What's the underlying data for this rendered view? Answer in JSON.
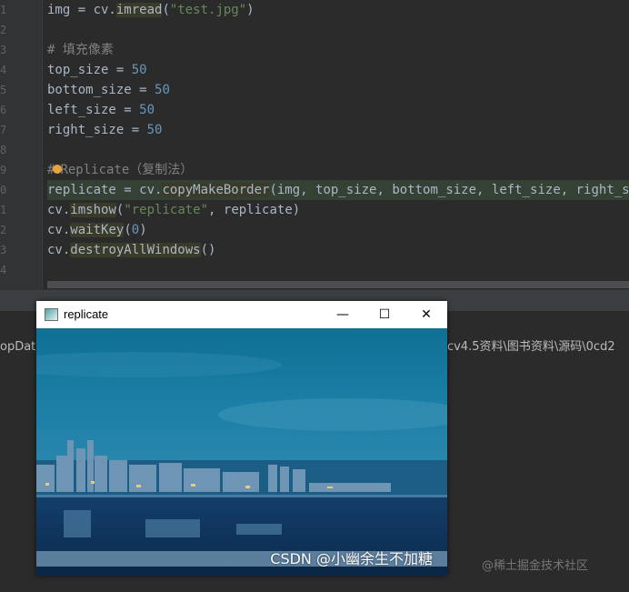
{
  "gutter": {
    "line_numbers": [
      "1",
      "2",
      "3",
      "4",
      "5",
      "6",
      "7",
      "8",
      "9",
      "0",
      "1",
      "2",
      "3",
      "4"
    ]
  },
  "code": {
    "l1": {
      "a": "img = cv.",
      "fn": "imread",
      "b": "(",
      "s": "\"test.jpg\"",
      "c": ")"
    },
    "l3": {
      "cmt": "# 填充像素"
    },
    "l4": {
      "a": "top_size = ",
      "n": "50"
    },
    "l5": {
      "a": "bottom_size = ",
      "n": "50"
    },
    "l6": {
      "a": "left_size = ",
      "n": "50"
    },
    "l7": {
      "a": "right_size = ",
      "n": "50"
    },
    "l9": {
      "c1": "#",
      "c2": "Replicate（复制法）"
    },
    "l10": {
      "a": "replicate = cv.",
      "fn": "copyMakeBorder",
      "b": "(img, top_size, bottom_size, left_size, right_size,"
    },
    "l11": {
      "a": "cv.",
      "fn": "imshow",
      "b": "(",
      "s": "\"replicate\"",
      "c": ", replicate)"
    },
    "l12": {
      "a": "cv.",
      "fn": "waitKey",
      "b": "(",
      "n": "0",
      "c": ")"
    },
    "l13": {
      "a": "cv.",
      "fn": "destroyAllWindows",
      "b": "()"
    }
  },
  "console": {
    "left_text": "opData",
    "right_text": "cv4.5资料\\图书资料\\源码\\0cd2"
  },
  "window": {
    "title": "replicate",
    "minimize": "—",
    "maximize": "☐",
    "close": "✕"
  },
  "watermark": {
    "main": "CSDN @小幽余生不加糖",
    "faint": "@稀土掘金技术社区"
  },
  "colors": {
    "editor_bg": "#2b2b2b",
    "string": "#6a8759",
    "number": "#6897bb",
    "comment": "#808080",
    "text": "#a9b7c6"
  }
}
